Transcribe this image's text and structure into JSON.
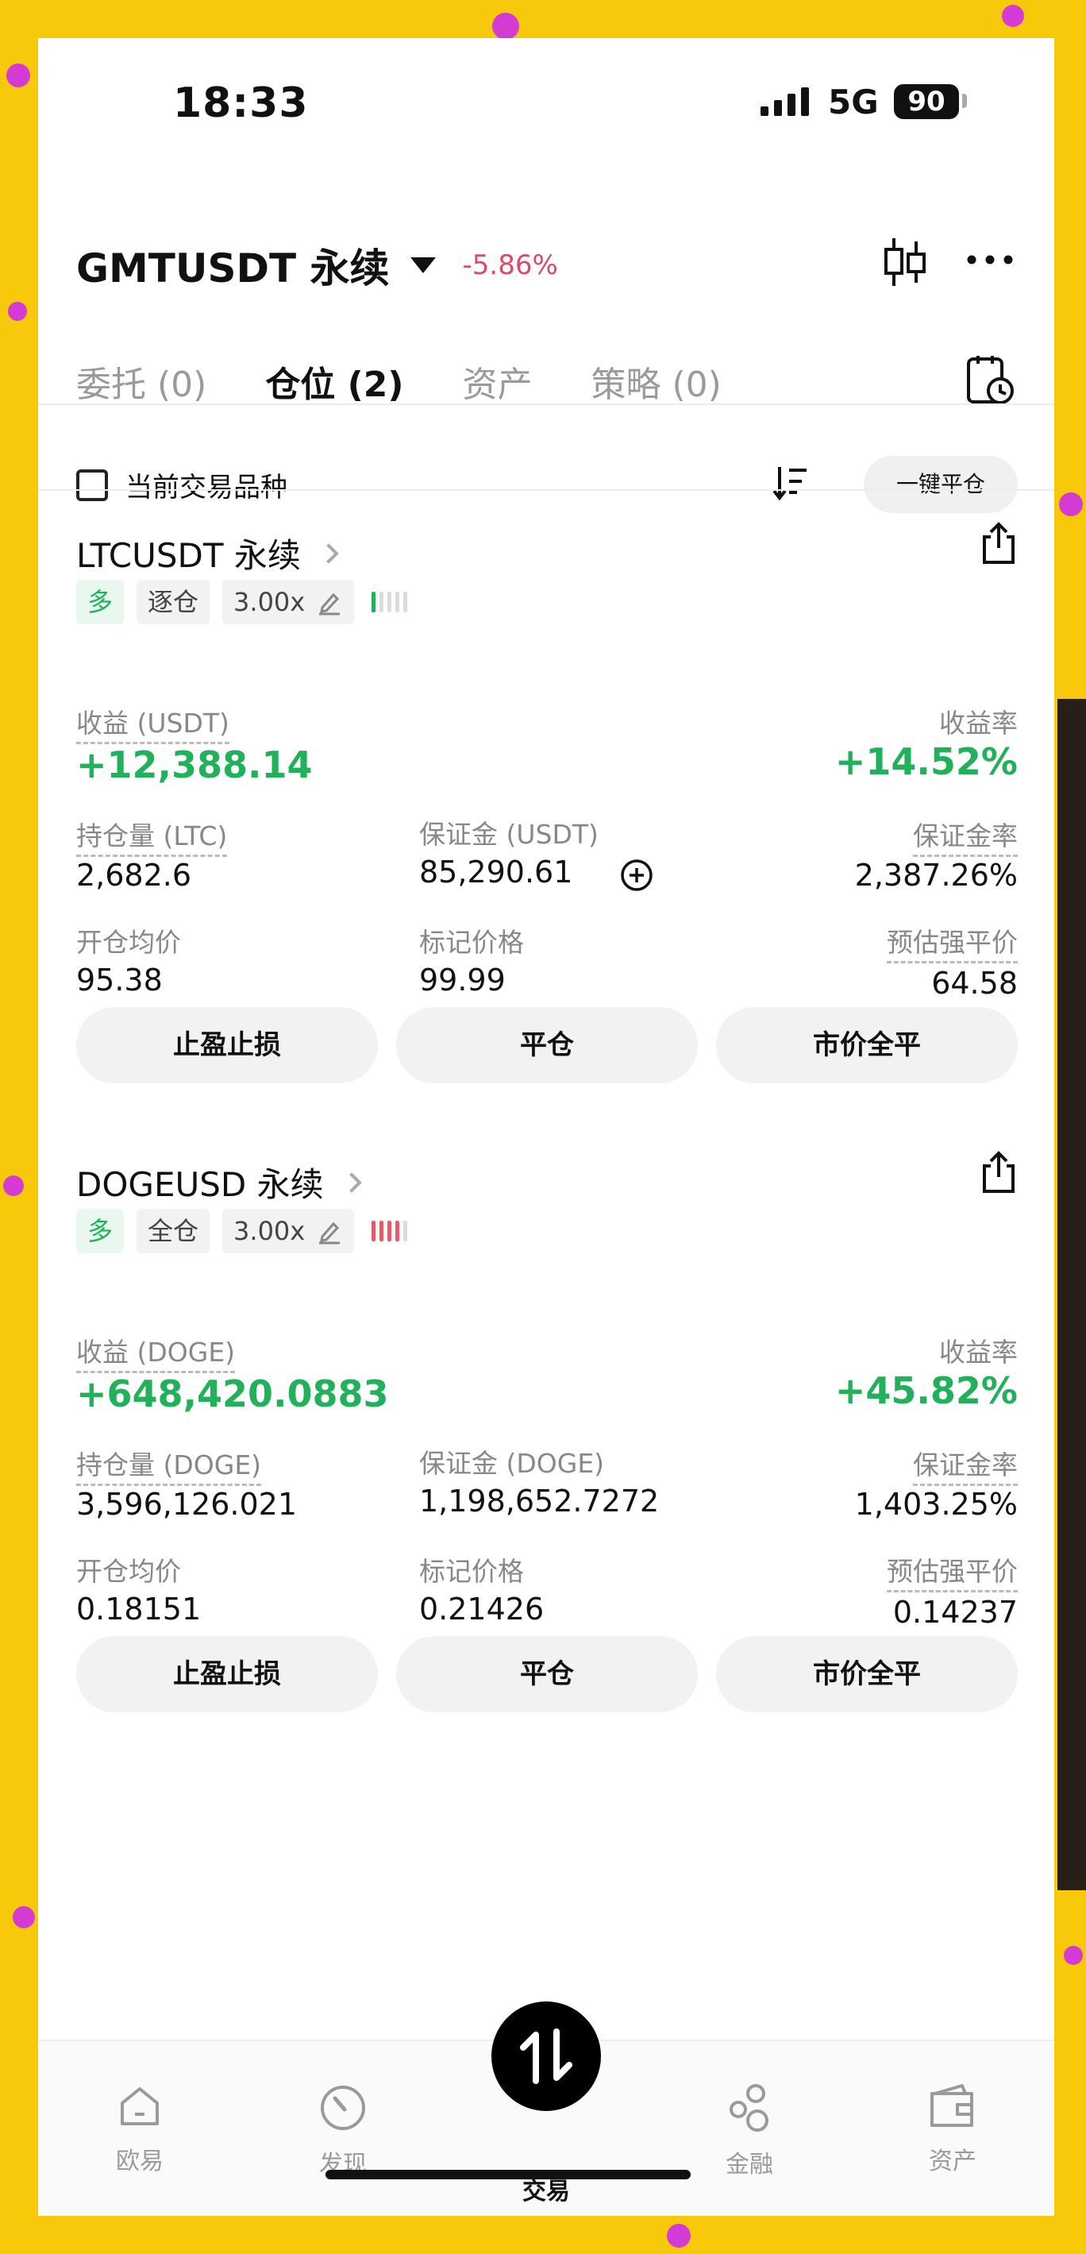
{
  "status_bar": {
    "time": "18:33",
    "network": "5G",
    "battery": "90"
  },
  "header": {
    "pair": "GMTUSDT 永续",
    "change": "-5.86%"
  },
  "tabs": [
    {
      "label": "委托 (0)",
      "active": false
    },
    {
      "label": "仓位 (2)",
      "active": true
    },
    {
      "label": "资产",
      "active": false
    },
    {
      "label": "策略 (0)",
      "active": false
    }
  ],
  "filter": {
    "current_pair_label": "当前交易品种",
    "close_all_label": "一键平仓"
  },
  "positions": [
    {
      "title": "LTCUSDT 永续",
      "side": "多",
      "margin_mode": "逐仓",
      "leverage": "3.00x",
      "pnl_label": "收益 (USDT)",
      "pnl": "+12,388.14",
      "roi_label": "收益率",
      "roi": "+14.52%",
      "size_label": "持仓量 (LTC)",
      "size": "2,682.6",
      "margin_label": "保证金 (USDT)",
      "margin": "85,290.61",
      "margin_ratio_label": "保证金率",
      "margin_ratio": "2,387.26%",
      "entry_label": "开仓均价",
      "entry": "95.38",
      "mark_label": "标记价格",
      "mark": "99.99",
      "liq_label": "预估强平价",
      "liq": "64.58",
      "buttons": [
        "止盈止损",
        "平仓",
        "市价全平"
      ]
    },
    {
      "title": "DOGEUSD 永续",
      "side": "多",
      "margin_mode": "全仓",
      "leverage": "3.00x",
      "pnl_label": "收益 (DOGE)",
      "pnl": "+648,420.0883",
      "roi_label": "收益率",
      "roi": "+45.82%",
      "size_label": "持仓量 (DOGE)",
      "size": "3,596,126.021",
      "margin_label": "保证金 (DOGE)",
      "margin": "1,198,652.7272",
      "margin_ratio_label": "保证金率",
      "margin_ratio": "1,403.25%",
      "entry_label": "开仓均价",
      "entry": "0.18151",
      "mark_label": "标记价格",
      "mark": "0.21426",
      "liq_label": "预估强平价",
      "liq": "0.14237",
      "buttons": [
        "止盈止损",
        "平仓",
        "市价全平"
      ]
    }
  ],
  "bottom_nav": [
    {
      "label": "欧易",
      "icon": "home-icon"
    },
    {
      "label": "发现",
      "icon": "discover-icon"
    },
    {
      "label": "交易",
      "icon": "trade-icon"
    },
    {
      "label": "金融",
      "icon": "finance-icon"
    },
    {
      "label": "资产",
      "icon": "wallet-icon"
    }
  ],
  "colors": {
    "positive": "#21b15a",
    "negative": "#d84c6a",
    "background": "#f7c90a",
    "dots": "#d43ad4"
  }
}
